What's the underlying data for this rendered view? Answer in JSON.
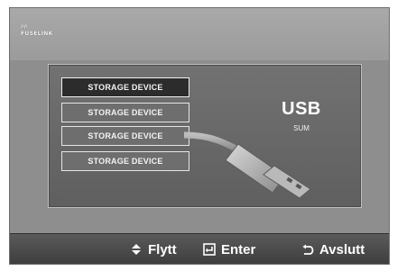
{
  "header": {
    "logo_line1": "PP",
    "logo_line2": "FUSELINK"
  },
  "device_list": {
    "items": [
      {
        "label": "STORAGE DEVICE",
        "selected": true
      },
      {
        "label": "STORAGE DEVICE",
        "selected": false
      },
      {
        "label": "STORAGE DEVICE",
        "selected": false
      },
      {
        "label": "STORAGE DEVICE",
        "selected": false
      }
    ]
  },
  "device_info": {
    "title": "USB",
    "subtitle": "SUM"
  },
  "footer": {
    "move_label": "Flytt",
    "move_icon": "up-down-arrows-icon",
    "enter_label": "Enter",
    "enter_icon": "enter-icon",
    "exit_label": "Avslutt",
    "exit_icon": "return-icon"
  },
  "colors": {
    "screen_bg": "#8e8e8e",
    "panel_bg": "#666666",
    "selected_item_bg": "#2c2c2c",
    "footer_bg": "#474747",
    "text": "#ffffff"
  }
}
